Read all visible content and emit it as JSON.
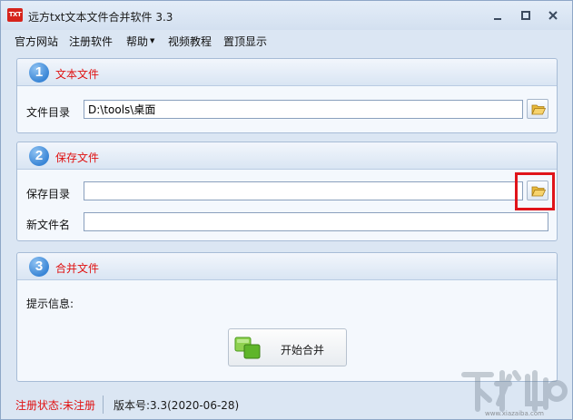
{
  "window": {
    "title": "远方txt文本文件合并软件 3.3",
    "icon_text": "TXT"
  },
  "menu": {
    "items": [
      "官方网站",
      "注册软件",
      "帮助",
      "视频教程",
      "置顶显示"
    ]
  },
  "section_text": {
    "number": "1",
    "title": "文本文件",
    "dir_label": "文件目录",
    "dir_value": "D:\\tools\\桌面"
  },
  "section_save": {
    "number": "2",
    "title": "保存文件",
    "dir_label": "保存目录",
    "dir_value": "",
    "filename_label": "新文件名",
    "filename_value": ""
  },
  "section_merge": {
    "number": "3",
    "title": "合并文件",
    "info_label": "提示信息:",
    "start_button": "开始合并"
  },
  "status": {
    "registration": "注册状态:未注册",
    "version": "版本号:3.3(2020-06-28)"
  },
  "watermark": {
    "url": "www.xiazaiba.com"
  },
  "colors": {
    "accent_red": "#e01010",
    "badge_blue": "#3a86d6",
    "window_bg": "#dbe6f3"
  }
}
